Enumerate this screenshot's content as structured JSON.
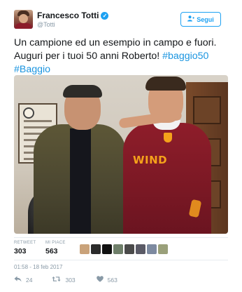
{
  "author": {
    "name": "Francesco Totti",
    "handle": "@Totti",
    "verified_glyph": "✓"
  },
  "follow_button": {
    "label": "Segui",
    "icon": "add-user-icon"
  },
  "tweet": {
    "line1": "Un campione ed un esempio in campo e fuori.",
    "line2_text": "Auguri per i tuoi 50 anni Roberto! ",
    "hashtag1": "#baggio50",
    "hashtag2": "#Baggio",
    "photo_jersey_text": "WIND"
  },
  "stats": {
    "retweets_label": "RETWEET",
    "retweets_count": "303",
    "likes_label": "MI PIACE",
    "likes_count": "563",
    "liker_avatar_colors": [
      "#c9a27a",
      "#2b2b2b",
      "#111111",
      "#6f7f6a",
      "#4a4a4a",
      "#5a5a66",
      "#7d8aa0",
      "#9aa07a"
    ]
  },
  "timestamp": "01:58 - 18 feb 2017",
  "actions": {
    "reply_count": "24",
    "retweet_count": "303",
    "like_count": "563"
  },
  "colors": {
    "accent": "#1da1f2",
    "hashtag": "#1b95e0",
    "muted": "#8899a6"
  }
}
